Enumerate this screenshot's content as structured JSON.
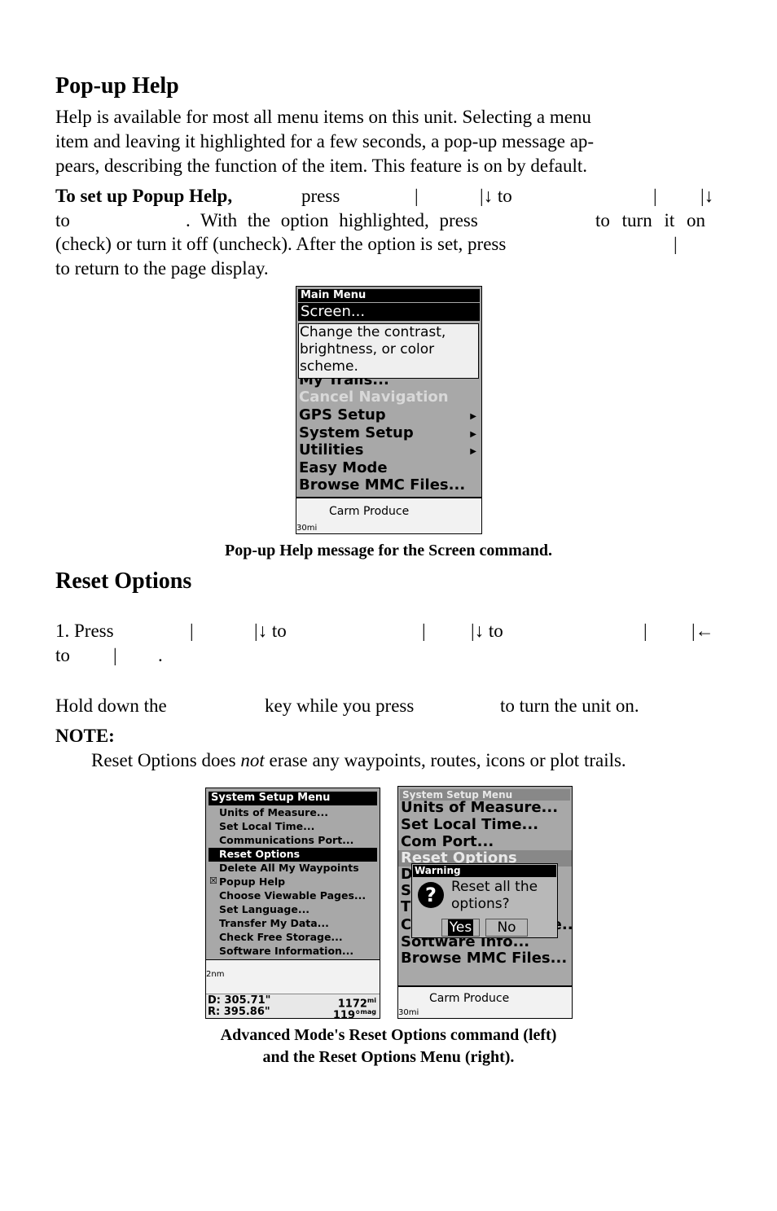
{
  "section1": {
    "title": "Pop-up Help",
    "para1": [
      "Help is available for most all menu items on this unit. Selecting a menu",
      "item and leaving it highlighted for a few seconds, a pop-up message ap-",
      "pears, describing the function of the item. This feature is on by default."
    ],
    "para2": {
      "lead": "To set up Popup Help,",
      "l1": [
        "press",
        "|",
        "|↓ to",
        "|",
        "|↓"
      ],
      "l2": [
        "to",
        ". With the option highlighted, press",
        "to turn it on"
      ],
      "l3": [
        "(check) or turn it off (uncheck). After the option is set, press",
        "|"
      ],
      "l4": "to return to the page display."
    },
    "screenshot": {
      "header": "Main Menu",
      "selected": "Screen...",
      "popup": [
        "Change the contrast,",
        "brightness, or color",
        "scheme."
      ],
      "items": [
        "My Trails...",
        "Cancel Navigation",
        "GPS Setup",
        "System Setup",
        "Utilities",
        "Easy Mode",
        "Browse MMC Files..."
      ],
      "map_label": "Carm Produce",
      "scale": "30mi"
    },
    "caption": "Pop-up Help message for the Screen command."
  },
  "section2": {
    "title": "Reset Options",
    "step1": {
      "l1": [
        "1. Press",
        "|",
        "|↓ to",
        "|",
        "|↓ to",
        "|",
        "|←"
      ],
      "l2": [
        "to",
        "|",
        "."
      ]
    },
    "hold": [
      "Hold down the",
      "key while you press",
      "to turn the unit on."
    ],
    "note_label": "NOTE:",
    "note": {
      "pre": "Reset Options does ",
      "em": "not",
      "post": " erase any waypoints, routes, icons or plot trails."
    },
    "left_shot": {
      "header": "System Setup Menu",
      "items": [
        "Units of Measure...",
        "Set Local Time...",
        "Communications Port...",
        "Reset Options",
        "Delete All My Waypoints",
        "Popup Help",
        "Choose Viewable Pages...",
        "Set Language...",
        "Transfer My Data...",
        "Check Free Storage...",
        "Software Information...",
        "Browse MMC Files..."
      ],
      "scale": "2nm",
      "d_label": "D: 305.71\"",
      "r_label": "R: 395.86\"",
      "dist": "1172",
      "dist_unit": "mi",
      "bearing": "119°",
      "bearing_unit": "mag"
    },
    "right_shot": {
      "header": "System Setup Menu",
      "items": [
        "Units of Measure...",
        "Set Local Time...",
        "Com Port...",
        "Reset Options",
        "D",
        "S",
        "T",
        "Check Free Storage...",
        "Software Info...",
        "Browse MMC Files..."
      ],
      "dialog_title": "Warning",
      "dialog_text": [
        "Reset all the",
        "options?"
      ],
      "yes": "Yes",
      "no": "No",
      "map_label": "Carm Produce",
      "scale": "30mi"
    },
    "caption": [
      "Advanced Mode's Reset Options command (left)",
      "and the Reset Options Menu (right)."
    ]
  }
}
